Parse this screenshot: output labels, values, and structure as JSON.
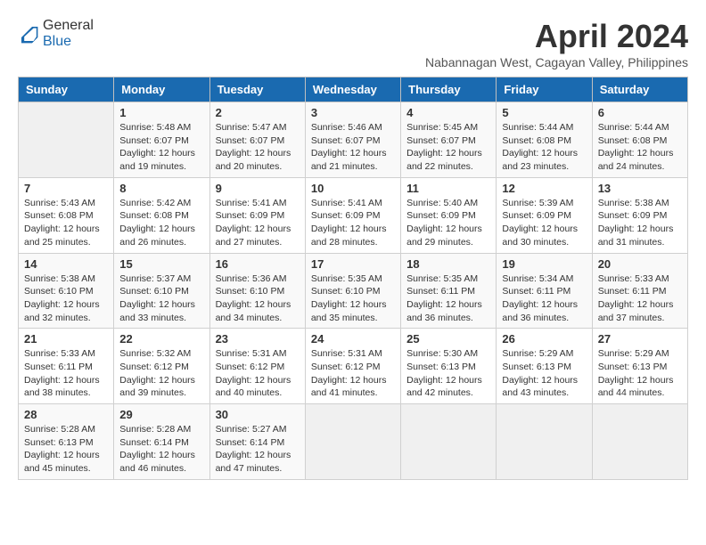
{
  "header": {
    "logo_general": "General",
    "logo_blue": "Blue",
    "title": "April 2024",
    "subtitle": "Nabannagan West, Cagayan Valley, Philippines"
  },
  "weekdays": [
    "Sunday",
    "Monday",
    "Tuesday",
    "Wednesday",
    "Thursday",
    "Friday",
    "Saturday"
  ],
  "weeks": [
    [
      {
        "day": "",
        "details": ""
      },
      {
        "day": "1",
        "details": "Sunrise: 5:48 AM\nSunset: 6:07 PM\nDaylight: 12 hours\nand 19 minutes."
      },
      {
        "day": "2",
        "details": "Sunrise: 5:47 AM\nSunset: 6:07 PM\nDaylight: 12 hours\nand 20 minutes."
      },
      {
        "day": "3",
        "details": "Sunrise: 5:46 AM\nSunset: 6:07 PM\nDaylight: 12 hours\nand 21 minutes."
      },
      {
        "day": "4",
        "details": "Sunrise: 5:45 AM\nSunset: 6:07 PM\nDaylight: 12 hours\nand 22 minutes."
      },
      {
        "day": "5",
        "details": "Sunrise: 5:44 AM\nSunset: 6:08 PM\nDaylight: 12 hours\nand 23 minutes."
      },
      {
        "day": "6",
        "details": "Sunrise: 5:44 AM\nSunset: 6:08 PM\nDaylight: 12 hours\nand 24 minutes."
      }
    ],
    [
      {
        "day": "7",
        "details": "Sunrise: 5:43 AM\nSunset: 6:08 PM\nDaylight: 12 hours\nand 25 minutes."
      },
      {
        "day": "8",
        "details": "Sunrise: 5:42 AM\nSunset: 6:08 PM\nDaylight: 12 hours\nand 26 minutes."
      },
      {
        "day": "9",
        "details": "Sunrise: 5:41 AM\nSunset: 6:09 PM\nDaylight: 12 hours\nand 27 minutes."
      },
      {
        "day": "10",
        "details": "Sunrise: 5:41 AM\nSunset: 6:09 PM\nDaylight: 12 hours\nand 28 minutes."
      },
      {
        "day": "11",
        "details": "Sunrise: 5:40 AM\nSunset: 6:09 PM\nDaylight: 12 hours\nand 29 minutes."
      },
      {
        "day": "12",
        "details": "Sunrise: 5:39 AM\nSunset: 6:09 PM\nDaylight: 12 hours\nand 30 minutes."
      },
      {
        "day": "13",
        "details": "Sunrise: 5:38 AM\nSunset: 6:09 PM\nDaylight: 12 hours\nand 31 minutes."
      }
    ],
    [
      {
        "day": "14",
        "details": "Sunrise: 5:38 AM\nSunset: 6:10 PM\nDaylight: 12 hours\nand 32 minutes."
      },
      {
        "day": "15",
        "details": "Sunrise: 5:37 AM\nSunset: 6:10 PM\nDaylight: 12 hours\nand 33 minutes."
      },
      {
        "day": "16",
        "details": "Sunrise: 5:36 AM\nSunset: 6:10 PM\nDaylight: 12 hours\nand 34 minutes."
      },
      {
        "day": "17",
        "details": "Sunrise: 5:35 AM\nSunset: 6:10 PM\nDaylight: 12 hours\nand 35 minutes."
      },
      {
        "day": "18",
        "details": "Sunrise: 5:35 AM\nSunset: 6:11 PM\nDaylight: 12 hours\nand 36 minutes."
      },
      {
        "day": "19",
        "details": "Sunrise: 5:34 AM\nSunset: 6:11 PM\nDaylight: 12 hours\nand 36 minutes."
      },
      {
        "day": "20",
        "details": "Sunrise: 5:33 AM\nSunset: 6:11 PM\nDaylight: 12 hours\nand 37 minutes."
      }
    ],
    [
      {
        "day": "21",
        "details": "Sunrise: 5:33 AM\nSunset: 6:11 PM\nDaylight: 12 hours\nand 38 minutes."
      },
      {
        "day": "22",
        "details": "Sunrise: 5:32 AM\nSunset: 6:12 PM\nDaylight: 12 hours\nand 39 minutes."
      },
      {
        "day": "23",
        "details": "Sunrise: 5:31 AM\nSunset: 6:12 PM\nDaylight: 12 hours\nand 40 minutes."
      },
      {
        "day": "24",
        "details": "Sunrise: 5:31 AM\nSunset: 6:12 PM\nDaylight: 12 hours\nand 41 minutes."
      },
      {
        "day": "25",
        "details": "Sunrise: 5:30 AM\nSunset: 6:13 PM\nDaylight: 12 hours\nand 42 minutes."
      },
      {
        "day": "26",
        "details": "Sunrise: 5:29 AM\nSunset: 6:13 PM\nDaylight: 12 hours\nand 43 minutes."
      },
      {
        "day": "27",
        "details": "Sunrise: 5:29 AM\nSunset: 6:13 PM\nDaylight: 12 hours\nand 44 minutes."
      }
    ],
    [
      {
        "day": "28",
        "details": "Sunrise: 5:28 AM\nSunset: 6:13 PM\nDaylight: 12 hours\nand 45 minutes."
      },
      {
        "day": "29",
        "details": "Sunrise: 5:28 AM\nSunset: 6:14 PM\nDaylight: 12 hours\nand 46 minutes."
      },
      {
        "day": "30",
        "details": "Sunrise: 5:27 AM\nSunset: 6:14 PM\nDaylight: 12 hours\nand 47 minutes."
      },
      {
        "day": "",
        "details": ""
      },
      {
        "day": "",
        "details": ""
      },
      {
        "day": "",
        "details": ""
      },
      {
        "day": "",
        "details": ""
      }
    ]
  ]
}
